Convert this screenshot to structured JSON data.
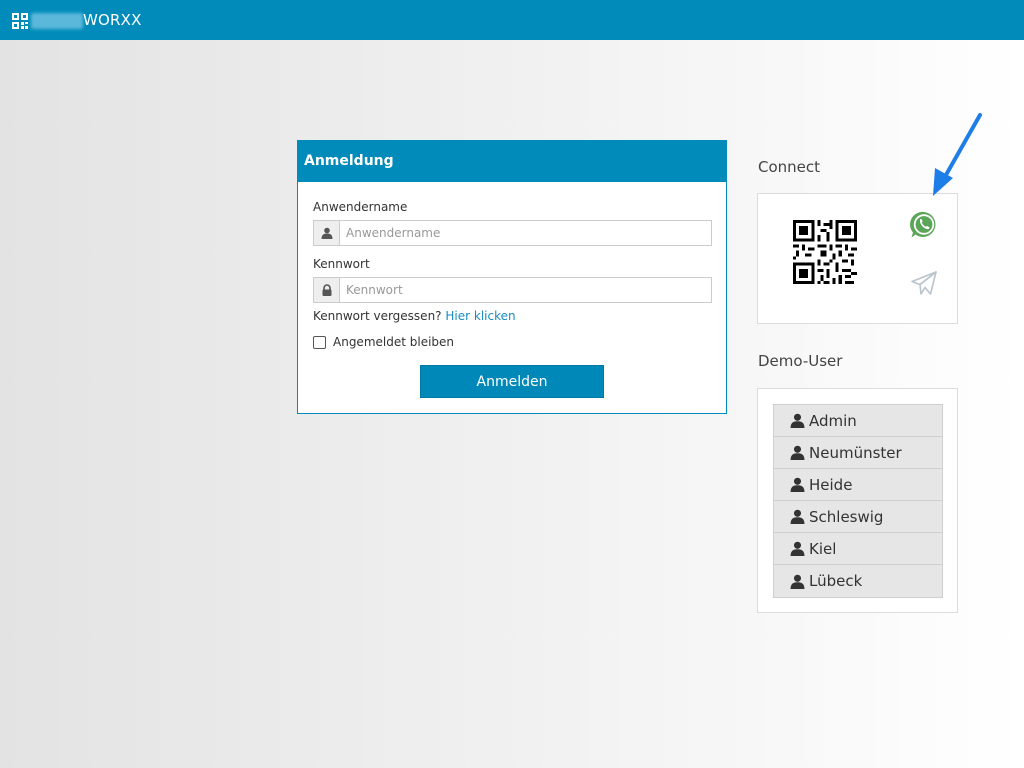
{
  "header": {
    "brand_suffix": "WORXX",
    "logo_icon": "qr-grid-icon",
    "bg_color": "#008bba"
  },
  "login": {
    "title": "Anmeldung",
    "username_label": "Anwendername",
    "username_placeholder": "Anwendername",
    "username_icon": "user-icon",
    "password_label": "Kennwort",
    "password_placeholder": "Kennwort",
    "password_icon": "lock-icon",
    "forgot_text": "Kennwort vergessen?",
    "forgot_link": "Hier klicken",
    "remember_label": "Angemeldet bleiben",
    "submit_label": "Anmelden"
  },
  "connect": {
    "title": "Connect",
    "icons": [
      "qr-code-icon",
      "whatsapp-icon",
      "telegram-icon"
    ]
  },
  "demo": {
    "title": "Demo-User",
    "users": [
      {
        "label": "Admin"
      },
      {
        "label": "Neumünster"
      },
      {
        "label": "Heide"
      },
      {
        "label": "Schleswig"
      },
      {
        "label": "Kiel"
      },
      {
        "label": "Lübeck"
      }
    ]
  },
  "annotation": {
    "arrow_color": "#1e7ee8",
    "arrow_icon": "pointer-arrow-icon"
  }
}
